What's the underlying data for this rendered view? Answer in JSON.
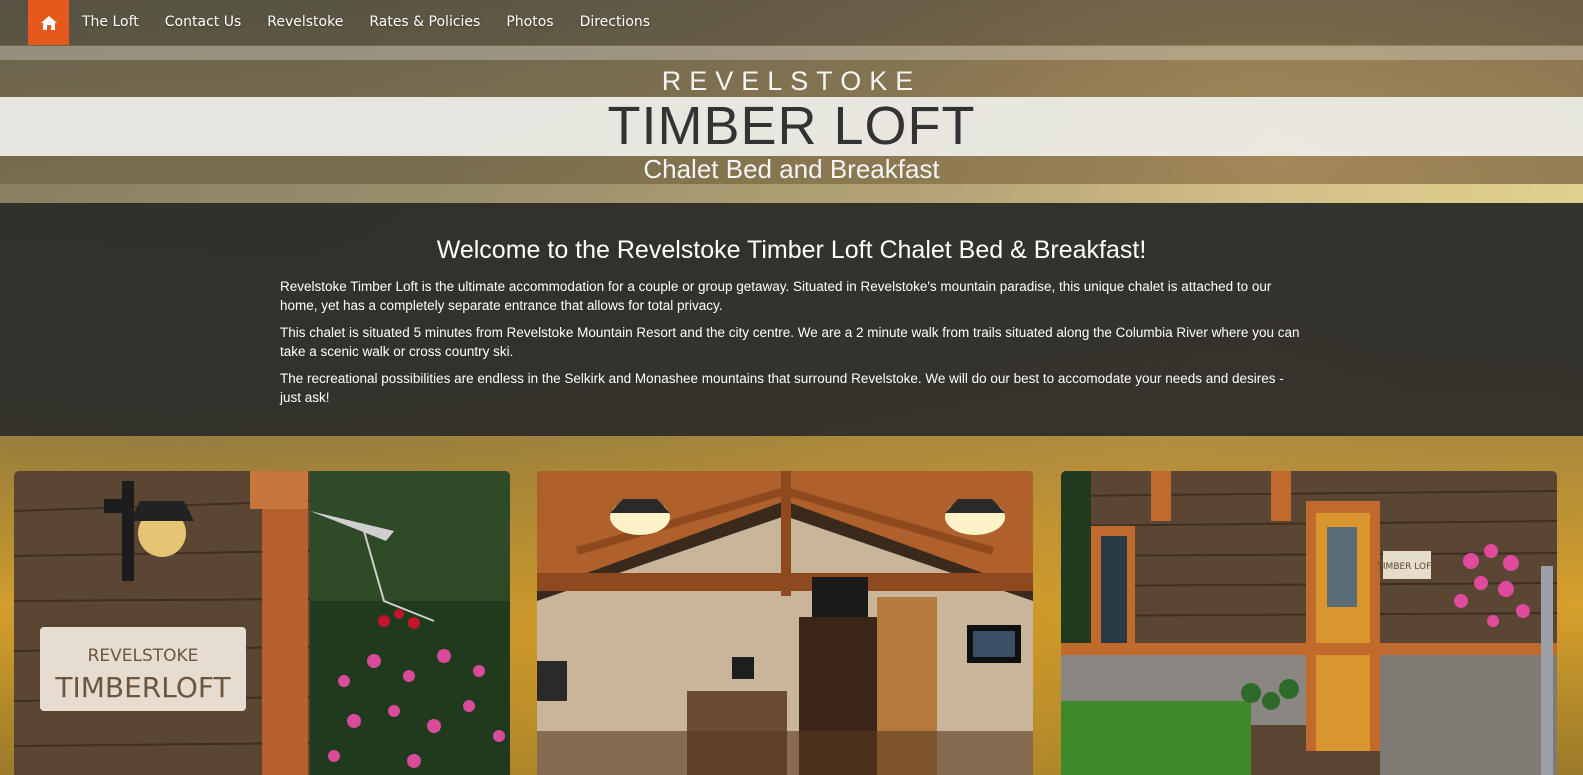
{
  "nav": {
    "home_icon": "home-icon",
    "items": [
      {
        "label": "The Loft"
      },
      {
        "label": "Contact Us"
      },
      {
        "label": "Revelstoke"
      },
      {
        "label": "Rates & Policies"
      },
      {
        "label": "Photos"
      },
      {
        "label": "Directions"
      }
    ],
    "accent_color": "#e55a1c"
  },
  "header": {
    "top": "REVELSTOKE",
    "main": "TIMBER LOFT",
    "sub": "Chalet Bed and Breakfast"
  },
  "welcome": {
    "title": "Welcome to the Revelstoke Timber Loft Chalet Bed & Breakfast!",
    "paragraphs": [
      "Revelstoke Timber Loft is the ultimate accommodation for a couple or group getaway. Situated in Revelstoke's mountain paradise, this unique chalet is attached to our home, yet has a completely separate entrance that allows for total privacy.",
      "This chalet is situated 5 minutes from Revelstoke Mountain Resort and the city centre. We are a 2 minute walk from trails situated along the Columbia River where you can take a scenic walk or cross country ski.",
      "The recreational possibilities are endless in the Selkirk and Monashee mountains that surround Revelstoke. We will do our best to accomodate your needs and desires - just ask!"
    ]
  },
  "photos": {
    "sign": {
      "line1": "REVELSTOKE",
      "line2": "TIMBERLOFT"
    },
    "door_sign": "TIMBER LOFT"
  }
}
